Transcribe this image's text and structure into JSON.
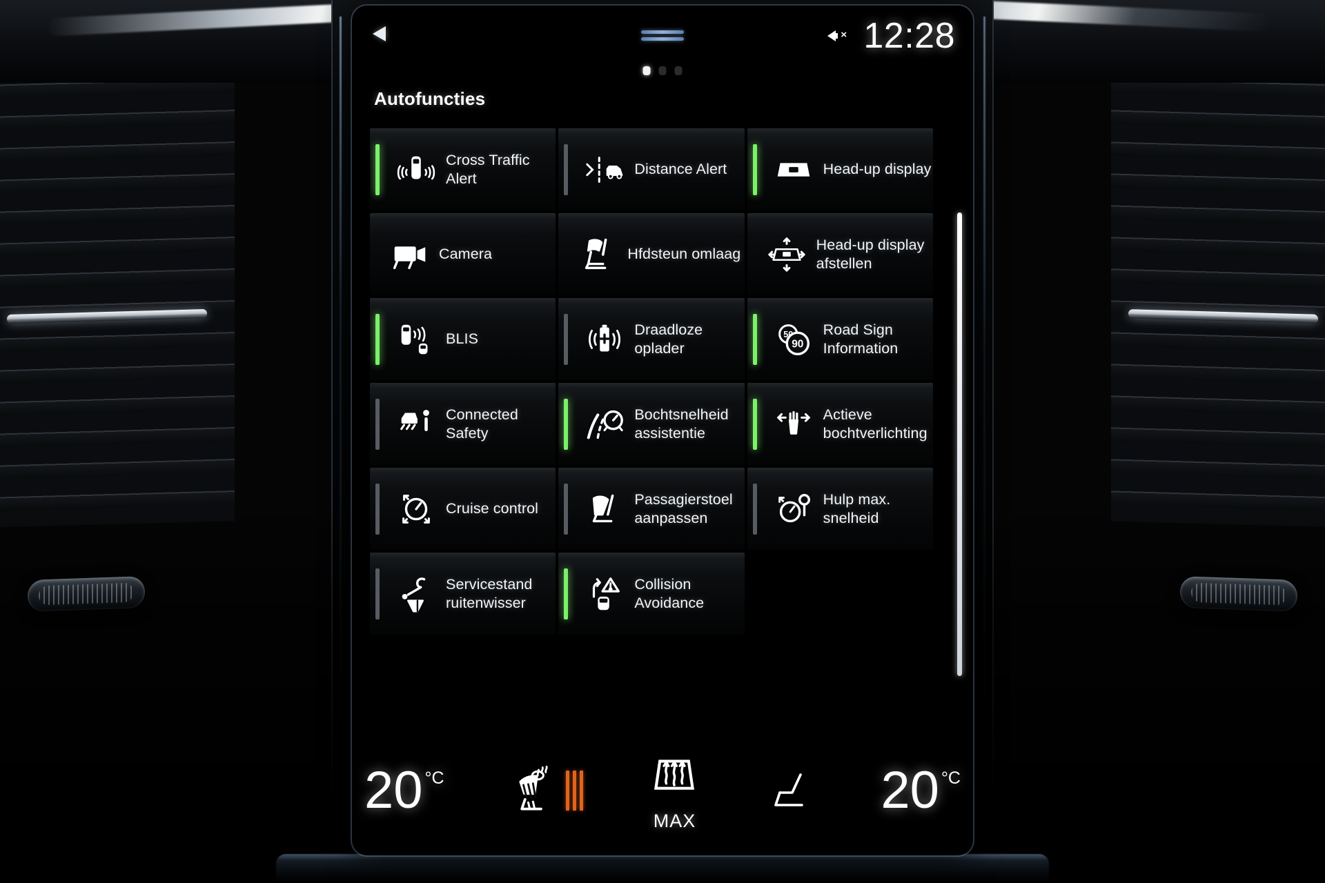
{
  "status_bar": {
    "nav_icon": "navigation-arrow-icon",
    "grip_icon": "drag-handle-icon",
    "mute_icon": "volume-mute-icon",
    "clock": "12:28",
    "page_dots": {
      "count": 3,
      "active_index": 0
    }
  },
  "page": {
    "title": "Autofuncties"
  },
  "tiles": [
    {
      "label": "Cross Traffic Alert",
      "icon": "cross-traffic-alert-icon",
      "indicator": "on"
    },
    {
      "label": "Distance Alert",
      "icon": "distance-alert-icon",
      "indicator": "off"
    },
    {
      "label": "Head-up display",
      "icon": "head-up-display-icon",
      "indicator": "on"
    },
    {
      "label": "Camera",
      "icon": "camera-icon",
      "indicator": "none"
    },
    {
      "label": "Hfdsteun omlaag",
      "icon": "headrest-down-icon",
      "indicator": "none"
    },
    {
      "label": "Head-up display afstellen",
      "icon": "head-up-display-adjust-icon",
      "indicator": "none"
    },
    {
      "label": "BLIS",
      "icon": "blind-spot-information-icon",
      "indicator": "on"
    },
    {
      "label": "Draadloze oplader",
      "icon": "wireless-charger-icon",
      "indicator": "off"
    },
    {
      "label": "Road Sign Information",
      "icon": "road-sign-information-icon",
      "indicator": "on"
    },
    {
      "label": "Connected Safety",
      "icon": "connected-safety-icon",
      "indicator": "off"
    },
    {
      "label": "Bochtsnelheid assistentie",
      "icon": "curve-speed-assist-icon",
      "indicator": "on"
    },
    {
      "label": "Actieve bochtverlichting",
      "icon": "active-bending-lights-icon",
      "indicator": "on"
    },
    {
      "label": "Cruise control",
      "icon": "cruise-control-icon",
      "indicator": "off"
    },
    {
      "label": "Passagierstoel aanpassen",
      "icon": "passenger-seat-adjust-icon",
      "indicator": "off"
    },
    {
      "label": "Hulp max. snelheid",
      "icon": "max-speed-assist-icon",
      "indicator": "off"
    },
    {
      "label": "Servicestand ruitenwisser",
      "icon": "wiper-service-position-icon",
      "indicator": "off"
    },
    {
      "label": "Collision Avoidance",
      "icon": "collision-avoidance-icon",
      "indicator": "on"
    },
    {
      "label": "",
      "icon": "",
      "indicator": "none"
    }
  ],
  "climate": {
    "left_temperature": "20",
    "left_unit": "°C",
    "right_temperature": "20",
    "right_unit": "°C",
    "heated_seat_icon": "heated-seat-icon",
    "heated_seat_level": 3,
    "defrost_icon": "max-defrost-icon",
    "defrost_label": "MAX",
    "seat_icon": "seat-icon"
  },
  "colors": {
    "indicator_on": "#7cf06a",
    "indicator_off": "#565c62",
    "heat_bar": "#e0641e",
    "text": "#f3f6f9",
    "grip_blue": "#93b2d6"
  }
}
